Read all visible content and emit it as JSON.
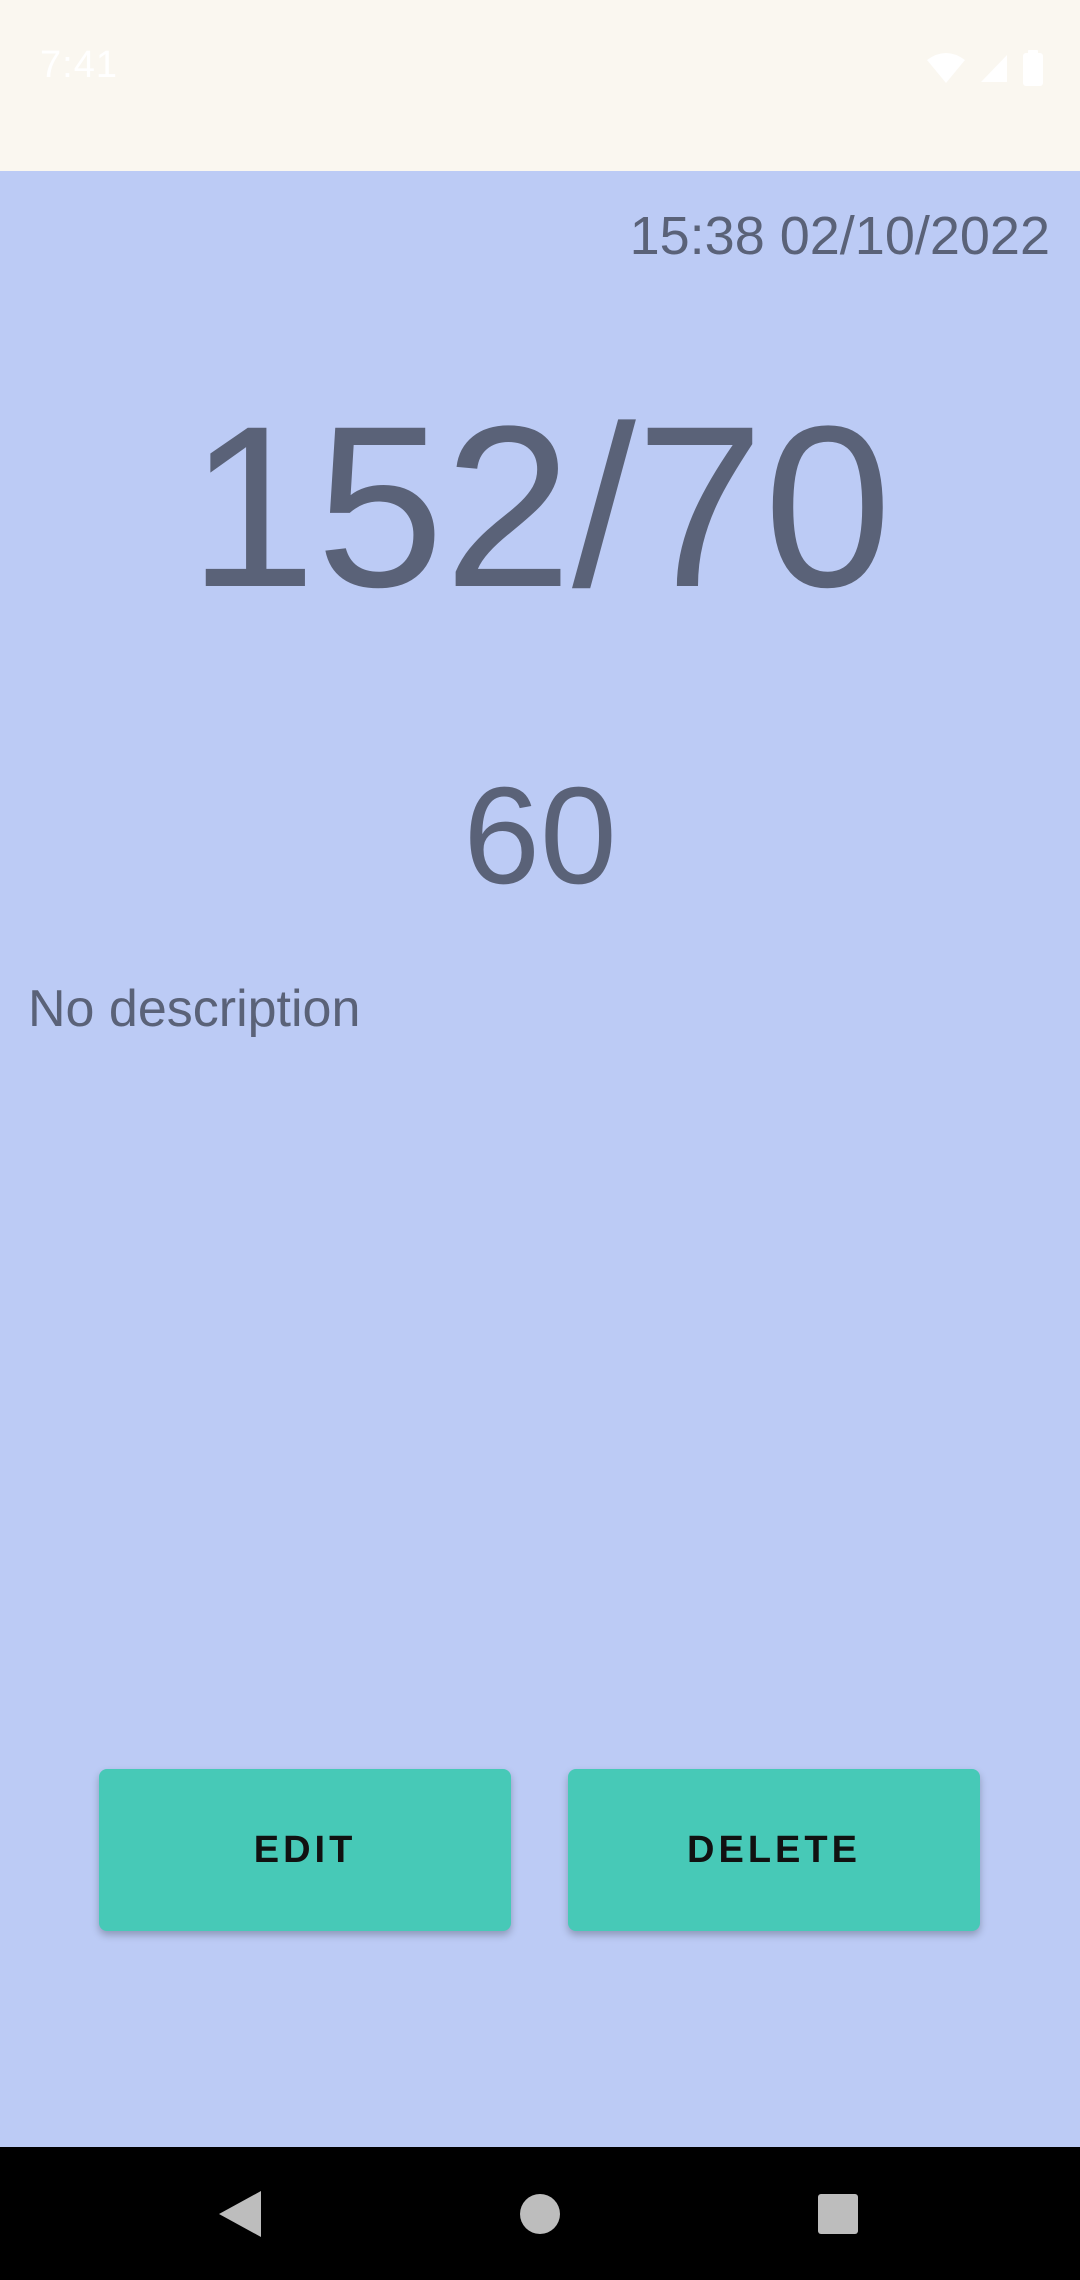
{
  "status_bar": {
    "time": "7:41",
    "icons": [
      "wifi-icon",
      "cell-signal-icon",
      "battery-icon"
    ]
  },
  "reading": {
    "datetime": "15:38 02/10/2022",
    "pressure": "152/70",
    "pulse": "60",
    "description": "No description"
  },
  "actions": {
    "edit_label": "EDIT",
    "delete_label": "DELETE"
  },
  "nav_bar": {
    "icons": [
      "back-icon",
      "home-icon",
      "recents-icon"
    ]
  },
  "colors": {
    "background": "#bccbf5",
    "status_bar": "#faf7f0",
    "button": "#47c9b7",
    "text": "#5a6278",
    "nav_bar": "#000000"
  }
}
